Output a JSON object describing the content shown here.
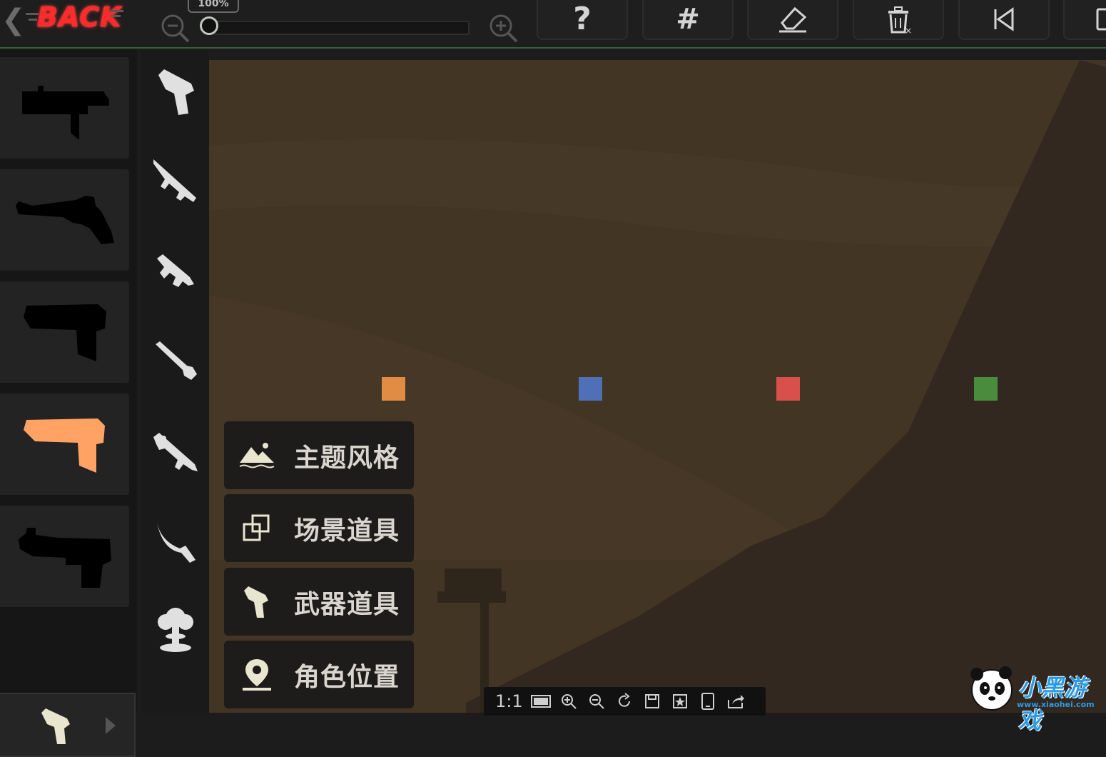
{
  "toolbar": {
    "back_label": "BACK",
    "zoom_percent": "100%",
    "zoom_level": 0.0,
    "icons": {
      "zoom_out": "zoom-out-icon",
      "zoom_in": "zoom-in-icon",
      "help": "question-mark-icon",
      "grid": "grid-hash-icon",
      "eraser": "eraser-icon",
      "delete": "trash-icon",
      "first": "skip-to-start-icon",
      "next": "device-icon"
    }
  },
  "weapon_list": {
    "items": [
      {
        "name": "uzi-smg",
        "selected": false
      },
      {
        "name": "flintlock-pistol",
        "selected": false
      },
      {
        "name": "blocky-pistol",
        "selected": false
      },
      {
        "name": "blocky-pistol",
        "selected": true,
        "color": "#ffa264"
      },
      {
        "name": "desert-eagle",
        "selected": false
      }
    ],
    "footer_icon": "pistol-icon",
    "footer_arrow": "chevron-right-icon"
  },
  "categories": [
    {
      "icon": "pistol-icon"
    },
    {
      "icon": "assault-rifle-icon"
    },
    {
      "icon": "submachine-gun-icon"
    },
    {
      "icon": "rocket-launcher-icon"
    },
    {
      "icon": "sniper-rifle-icon"
    },
    {
      "icon": "knife-icon"
    },
    {
      "icon": "explosion-icon"
    }
  ],
  "spawn_markers": [
    {
      "color": "#e08c45"
    },
    {
      "color": "#4f6fb7"
    },
    {
      "color": "#d9504a"
    },
    {
      "color": "#4a8c3e"
    }
  ],
  "menu": [
    {
      "label": "主题风格",
      "icon": "mountain-landscape-icon"
    },
    {
      "label": "场景道具",
      "icon": "overlapping-squares-icon"
    },
    {
      "label": "武器道具",
      "icon": "pistol-icon"
    },
    {
      "label": "角色位置",
      "icon": "location-pin-icon"
    }
  ],
  "viewer_bar": {
    "ratio_label": "1:1",
    "icons": [
      "fit-screen-icon",
      "zoom-in-icon",
      "zoom-out-icon",
      "rotate-icon",
      "save-icon",
      "bookmark-star-icon",
      "tablet-icon",
      "share-icon"
    ]
  },
  "watermark": {
    "brand": "小黑游戏",
    "url": "www.xiaohei.com"
  },
  "colors": {
    "accent_green": "#3b5c3e",
    "back_red": "#ff2a2a",
    "selected_weapon": "#ffa264",
    "canvas_bg": "#433524"
  }
}
